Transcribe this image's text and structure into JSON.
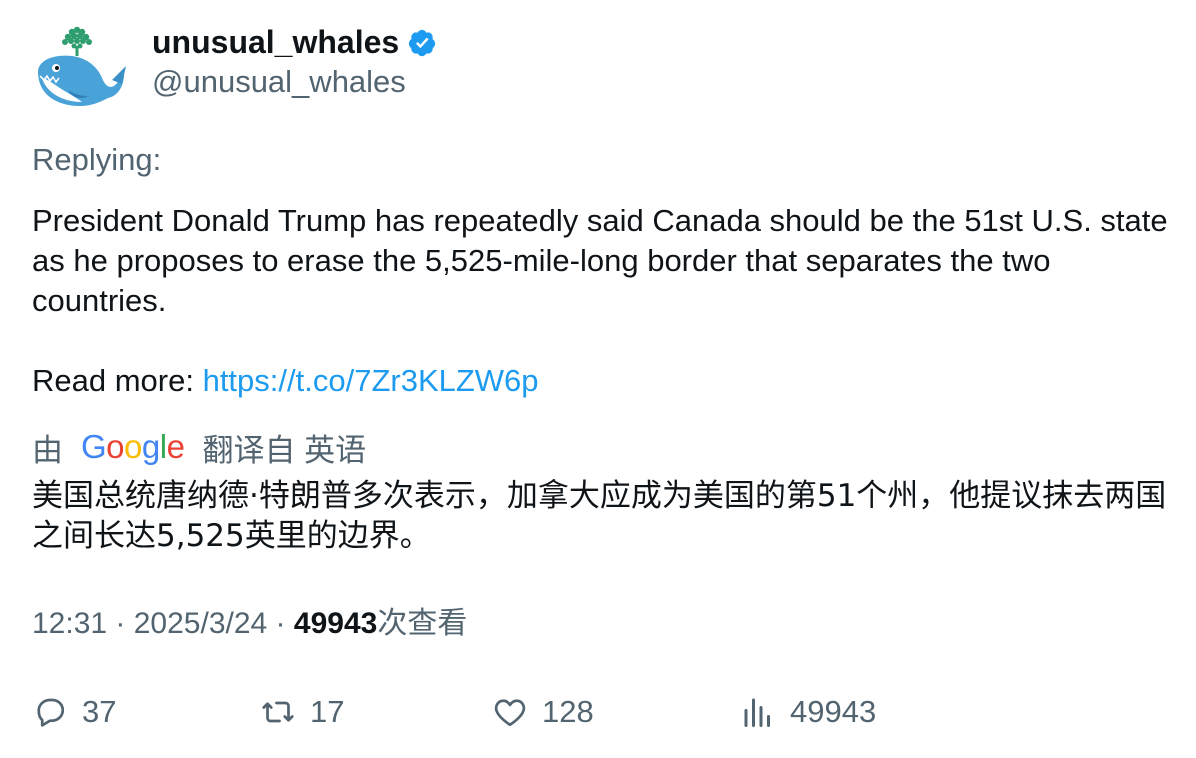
{
  "author": {
    "name": "unusual_whales",
    "handle": "@unusual_whales",
    "verified": true,
    "avatar_icon": "whale-logo-icon",
    "verified_color": "#1d9bf0"
  },
  "replying_label": "Replying:",
  "body": {
    "text": "President Donald Trump has repeatedly said Canada should be the 51st U.S. state as he proposes to erase the 5,525-mile-long border that separates the two countries.",
    "read_more_label": "Read more: ",
    "link": "https://t.co/7Zr3KLZW6p"
  },
  "translation": {
    "prefix": "由",
    "provider_letters": [
      "G",
      "o",
      "o",
      "g",
      "l",
      "e"
    ],
    "provider_colors": [
      "#4285f4",
      "#ea4335",
      "#fbbc05",
      "#4285f4",
      "#34a853",
      "#ea4335"
    ],
    "suffix": "翻译自 英语",
    "text": "美国总统唐纳德·特朗普多次表示，加拿大应成为美国的第51个州，他提议抹去两国之间长达5,525英里的边界。"
  },
  "meta": {
    "time": "12:31",
    "separator": " · ",
    "date": "2025/3/24",
    "views_count": "49943",
    "views_label": "次查看"
  },
  "actions": {
    "replies": "37",
    "retweets": "17",
    "likes": "128",
    "views": "49943"
  },
  "colors": {
    "text": "#0f1419",
    "secondary": "#536471",
    "link": "#1d9bf0"
  }
}
